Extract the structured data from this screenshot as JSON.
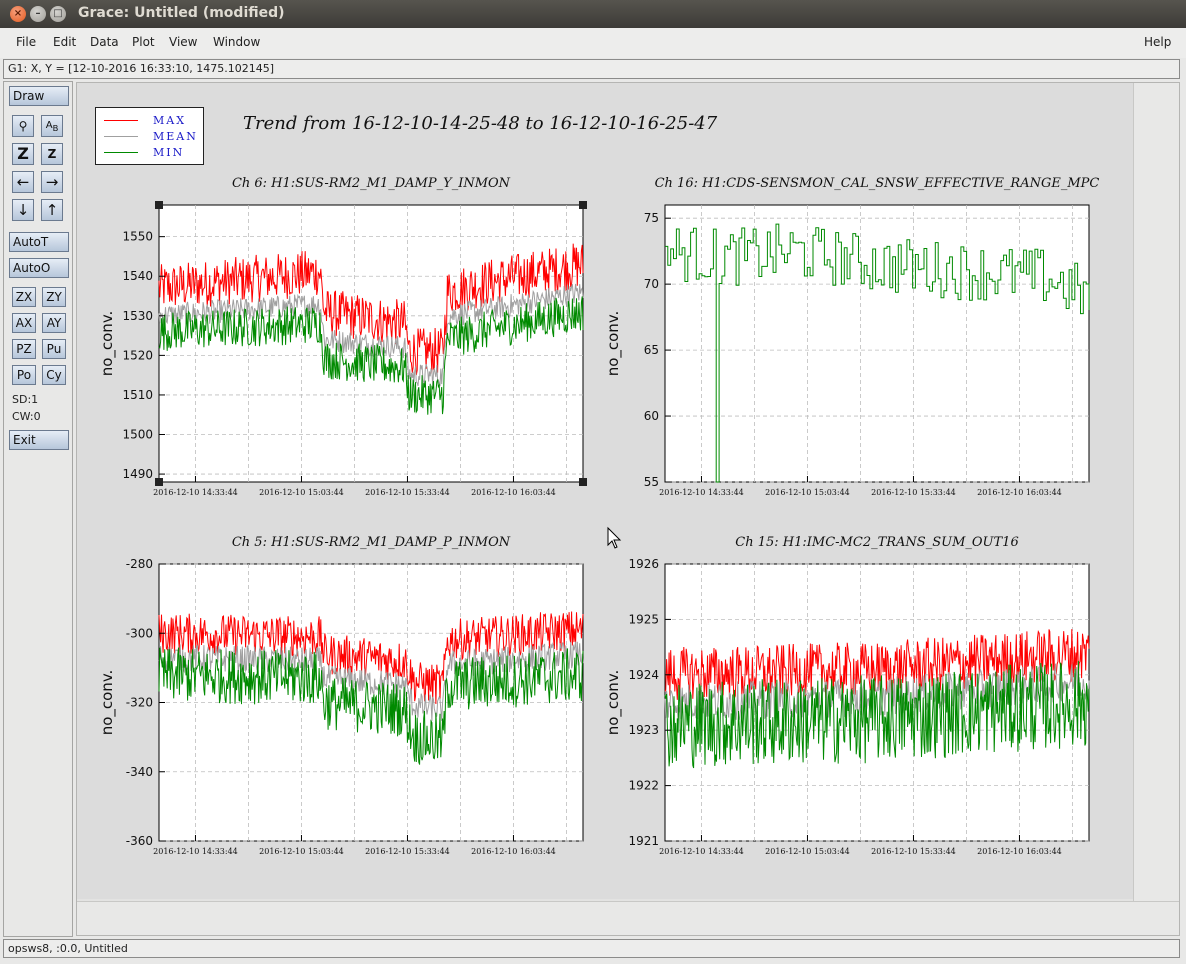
{
  "window": {
    "title": "Grace: Untitled (modified)"
  },
  "menu": {
    "items": [
      "File",
      "Edit",
      "Data",
      "Plot",
      "View",
      "Window"
    ],
    "help": "Help"
  },
  "coord_readout": "G1: X, Y = [12-10-2016 16:33:10, 1475.102145]",
  "toolbar": {
    "draw": "Draw",
    "autot": "AutoT",
    "autoo": "AutoO",
    "zx": "ZX",
    "zy": "ZY",
    "ax": "AX",
    "ay": "AY",
    "pz": "PZ",
    "pu": "Pu",
    "po": "Po",
    "cy": "Cy",
    "z": "Z",
    "sd": "SD:1",
    "cw": "CW:0",
    "exit": "Exit"
  },
  "status": "opsws8, :0.0, Untitled",
  "legend": [
    {
      "label": "MAX",
      "color": "#ff0000"
    },
    {
      "label": "MEAN",
      "color": "#a0a0a0"
    },
    {
      "label": "MIN",
      "color": "#008a00"
    }
  ],
  "plot_title": "Trend from 16-12-10-14-25-48 to 16-12-10-16-25-47",
  "chart_data": [
    {
      "type": "line",
      "title": "Ch 6: H1:SUS-RM2_M1_DAMP_Y_INMON",
      "ylabel": "no_conv.",
      "xlabel": "",
      "ylim": [
        1488,
        1558
      ],
      "yticks": [
        1490,
        1500,
        1510,
        1520,
        1530,
        1540,
        1550
      ],
      "xtick_labels": [
        "2016-12-10 14:33:44",
        "2016-12-10 15:03:44",
        "2016-12-10 15:33:44",
        "2016-12-10 16:03:44"
      ],
      "grid": true,
      "series": [
        {
          "name": "MAX",
          "color": "#ff0000",
          "baseline": [
            [
              0,
              1537
            ],
            [
              0.38,
              1541
            ],
            [
              0.39,
              1531
            ],
            [
              0.58,
              1528
            ],
            [
              0.59,
              1521
            ],
            [
              0.67,
              1521
            ],
            [
              0.68,
              1536
            ],
            [
              0.8,
              1539
            ],
            [
              1,
              1543
            ]
          ],
          "noise": 6
        },
        {
          "name": "MEAN",
          "color": "#a0a0a0",
          "baseline": [
            [
              0,
              1530
            ],
            [
              0.38,
              1533
            ],
            [
              0.39,
              1524
            ],
            [
              0.58,
              1522
            ],
            [
              0.59,
              1515
            ],
            [
              0.67,
              1515
            ],
            [
              0.68,
              1530
            ],
            [
              0.8,
              1532
            ],
            [
              1,
              1536
            ]
          ],
          "noise": 3
        },
        {
          "name": "MIN",
          "color": "#008a00",
          "baseline": [
            [
              0,
              1526
            ],
            [
              0.38,
              1528
            ],
            [
              0.39,
              1519
            ],
            [
              0.58,
              1517
            ],
            [
              0.59,
              1510
            ],
            [
              0.67,
              1510
            ],
            [
              0.68,
              1524
            ],
            [
              0.8,
              1527
            ],
            [
              1,
              1531
            ]
          ],
          "noise": 5
        }
      ]
    },
    {
      "type": "line",
      "title": "Ch 16: H1:CDS-SENSMON_CAL_SNSW_EFFECTIVE_RANGE_MPC",
      "ylabel": "no_conv.",
      "xlabel": "",
      "ylim": [
        55,
        76
      ],
      "yticks": [
        55,
        60,
        65,
        70,
        75
      ],
      "xtick_labels": [
        "2016-12-10 14:33:44",
        "2016-12-10 15:03:44",
        "2016-12-10 15:33:44",
        "2016-12-10 16:03:44"
      ],
      "grid": true,
      "series": [
        {
          "name": "MIN",
          "color": "#008a00",
          "baseline": [
            [
              0,
              72.5
            ],
            [
              0.15,
              72
            ],
            [
              0.3,
              72.5
            ],
            [
              0.5,
              71.5
            ],
            [
              0.7,
              71
            ],
            [
              0.9,
              70.5
            ],
            [
              1,
              69
            ]
          ],
          "noise": 2.2,
          "step": true,
          "dip": {
            "at": 0.12,
            "value": 55
          }
        }
      ]
    },
    {
      "type": "line",
      "title": "Ch 5: H1:SUS-RM2_M1_DAMP_P_INMON",
      "ylabel": "no_conv.",
      "xlabel": "",
      "ylim": [
        -360,
        -280
      ],
      "yticks": [
        -280,
        -300,
        -320,
        -340,
        -360
      ],
      "xtick_labels": [
        "2016-12-10 14:33:44",
        "2016-12-10 15:03:44",
        "2016-12-10 15:33:44",
        "2016-12-10 16:03:44"
      ],
      "grid": true,
      "series": [
        {
          "name": "MAX",
          "color": "#ff0000",
          "baseline": [
            [
              0,
              -300
            ],
            [
              0.38,
              -301
            ],
            [
              0.39,
              -306
            ],
            [
              0.58,
              -308
            ],
            [
              0.6,
              -314
            ],
            [
              0.67,
              -315
            ],
            [
              0.68,
              -302
            ],
            [
              1,
              -299
            ]
          ],
          "noise": 6
        },
        {
          "name": "MEAN",
          "color": "#a0a0a0",
          "baseline": [
            [
              0,
              -307
            ],
            [
              0.38,
              -308
            ],
            [
              0.39,
              -313
            ],
            [
              0.58,
              -315
            ],
            [
              0.6,
              -321
            ],
            [
              0.67,
              -322
            ],
            [
              0.68,
              -309
            ],
            [
              1,
              -306
            ]
          ],
          "noise": 4
        },
        {
          "name": "MIN",
          "color": "#008a00",
          "baseline": [
            [
              0,
              -312
            ],
            [
              0.38,
              -313
            ],
            [
              0.39,
              -320
            ],
            [
              0.58,
              -322
            ],
            [
              0.6,
              -330
            ],
            [
              0.67,
              -331
            ],
            [
              0.68,
              -315
            ],
            [
              1,
              -312
            ]
          ],
          "noise": 8
        }
      ]
    },
    {
      "type": "line",
      "title": "Ch 15: H1:IMC-MC2_TRANS_SUM_OUT16",
      "ylabel": "no_conv.",
      "xlabel": "",
      "ylim": [
        1921,
        1926
      ],
      "yticks": [
        1921,
        1922,
        1923,
        1924,
        1925,
        1926
      ],
      "xtick_labels": [
        "2016-12-10 14:33:44",
        "2016-12-10 15:03:44",
        "2016-12-10 15:33:44",
        "2016-12-10 16:03:44"
      ],
      "grid": true,
      "series": [
        {
          "name": "MAX",
          "color": "#ff0000",
          "baseline": [
            [
              0,
              1924
            ],
            [
              0.5,
              1924.1
            ],
            [
              1,
              1924.4
            ]
          ],
          "noise": 0.5
        },
        {
          "name": "MEAN",
          "color": "#a0a0a0",
          "baseline": [
            [
              0,
              1923.5
            ],
            [
              0.5,
              1923.6
            ],
            [
              1,
              1923.9
            ]
          ],
          "noise": 0.35
        },
        {
          "name": "MIN",
          "color": "#008a00",
          "baseline": [
            [
              0,
              1923.1
            ],
            [
              0.5,
              1923.2
            ],
            [
              1,
              1923.5
            ]
          ],
          "noise": 0.8
        }
      ]
    }
  ]
}
